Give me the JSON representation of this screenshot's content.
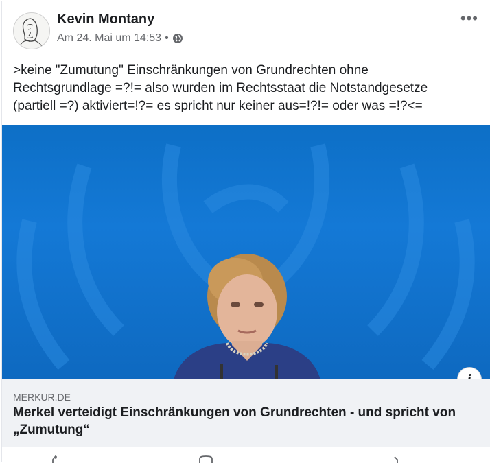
{
  "post": {
    "author": "Kevin Montany",
    "timestamp": "Am 24. Mai um 14:53",
    "separator": "•",
    "privacy_icon": "globe-icon",
    "more_label": "•••",
    "text_lines": [
      ">keine \"Zumutung\" Einschränkungen von Grundrechten ohne",
      "Rechtsgrundlage =?!= also wurden im Rechtsstaat die Notstandgesetze",
      "(partiell =?) aktiviert=!?= es spricht nur keiner aus=!?!= oder was =!?<="
    ]
  },
  "link_preview": {
    "domain": "MERKUR.DE",
    "title_lines": [
      "Merkel verteidigt Einschränkungen von Grundrechten - und spricht von",
      "„Zumutung“"
    ],
    "info_label": "i"
  },
  "actions": {
    "icons": [
      "like-icon",
      "comment-icon",
      "share-icon"
    ]
  },
  "colors": {
    "image_background": "#1479d6",
    "meta_text": "#65676b",
    "link_box": "#f0f2f5"
  }
}
